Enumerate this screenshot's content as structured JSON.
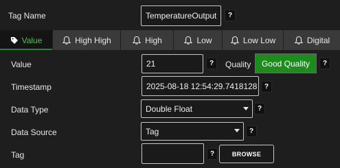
{
  "tag_name": {
    "label": "Tag Name",
    "value": "TemperatureOutput",
    "help": "?"
  },
  "tabs": [
    {
      "label": "Value",
      "icon": "tag-icon",
      "active": true
    },
    {
      "label": "High High",
      "icon": "bell-icon",
      "active": false
    },
    {
      "label": "High",
      "icon": "bell-icon",
      "active": false
    },
    {
      "label": "Low",
      "icon": "bell-icon",
      "active": false
    },
    {
      "label": "Low Low",
      "icon": "bell-icon",
      "active": false
    },
    {
      "label": "Digital",
      "icon": "bell-icon",
      "active": false
    }
  ],
  "value": {
    "label": "Value",
    "value": "21",
    "help": "?"
  },
  "quality": {
    "label": "Quality",
    "value": "Good Quality",
    "help": "?",
    "color": "#1c8c1c"
  },
  "timestamp": {
    "label": "Timestamp",
    "value": "2025-08-18 12:54:29.7418128",
    "help": "?"
  },
  "data_type": {
    "label": "Data Type",
    "value": "Double Float",
    "help": "?"
  },
  "data_source": {
    "label": "Data Source",
    "value": "Tag",
    "help": "?"
  },
  "tag": {
    "label": "Tag",
    "value": "",
    "help": "?",
    "browse_label": "BROWSE"
  },
  "colors": {
    "accent": "#4fc24f",
    "background": "#1e1e1e",
    "tab": "#3a3a3a"
  }
}
